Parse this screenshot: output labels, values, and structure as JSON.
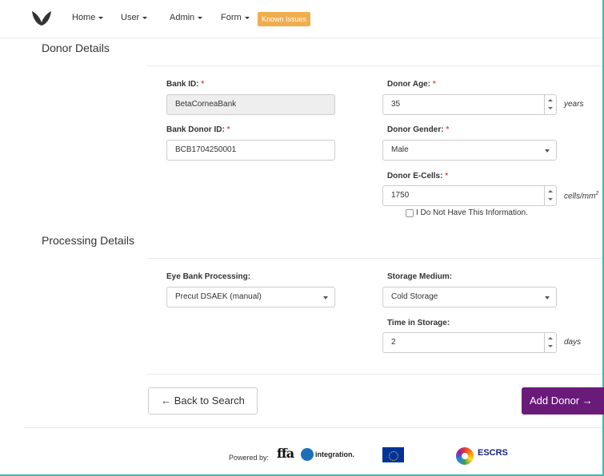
{
  "nav": {
    "items": [
      {
        "label": "Home"
      },
      {
        "label": "User"
      },
      {
        "label": "Admin"
      },
      {
        "label": "Form"
      }
    ],
    "known_issues": "Known Issues"
  },
  "donor_details": {
    "title": "Donor Details",
    "bank_id": {
      "label": "Bank ID:",
      "value": "BetaCorneaBank"
    },
    "bank_donor_id": {
      "label": "Bank Donor ID:",
      "value": "BCB1704250001"
    },
    "donor_age": {
      "label": "Donor Age:",
      "value": "35",
      "unit": "years"
    },
    "donor_gender": {
      "label": "Donor Gender:",
      "value": "Male"
    },
    "donor_ecells": {
      "label": "Donor E-Cells:",
      "value": "1750",
      "unit": "cells/mm",
      "unit_sup": "2"
    },
    "no_info_checkbox": {
      "label": "I Do Not Have This Information.",
      "checked": false
    },
    "required_mark": "*"
  },
  "processing_details": {
    "title": "Processing Details",
    "eye_bank_processing": {
      "label": "Eye Bank Processing:",
      "value": "Precut DSAEK (manual)"
    },
    "storage_medium": {
      "label": "Storage Medium:",
      "value": "Cold Storage"
    },
    "time_in_storage": {
      "label": "Time in Storage:",
      "value": "2",
      "unit": "days"
    }
  },
  "actions": {
    "back": "← Back to Search",
    "add": "Add Donor →"
  },
  "footer": {
    "powered_by": "Powered by:",
    "ffa": "ffa",
    "integration": "integration.",
    "escrs": "ESCRS"
  },
  "colors": {
    "accent_purple": "#6a1b7a",
    "known_issues_orange": "#f0ad4e",
    "required_red": "#d9534f",
    "frame_teal": "#3fb9b0"
  }
}
